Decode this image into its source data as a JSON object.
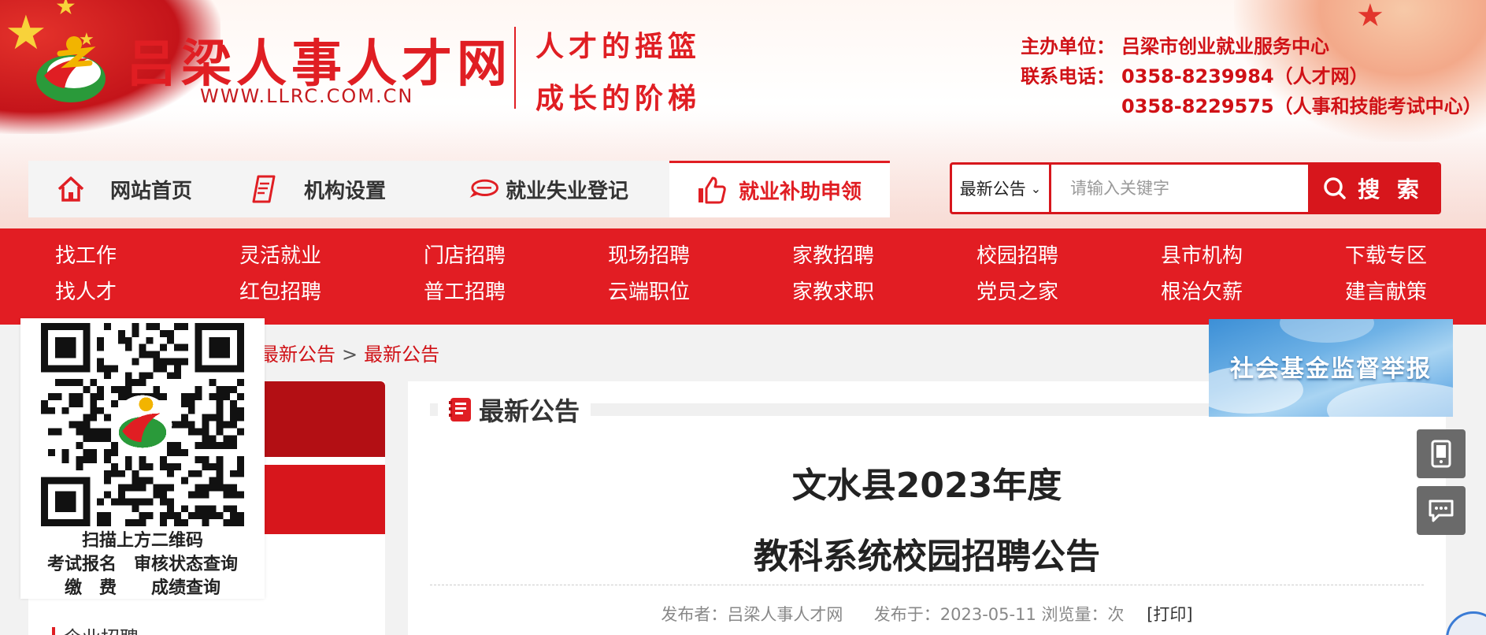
{
  "header": {
    "site_name": "吕梁人事人才网",
    "site_url": "WWW.LLRC.COM.CN",
    "slogan_line1": "人才的摇篮",
    "slogan_line2": "成长的阶梯",
    "host_label": "主办单位：",
    "host_value": "吕梁市创业就业服务中心",
    "phone_label": "联系电话：",
    "phone1": "0358-8239984（人才网）",
    "phone2": "0358-8229575（人事和技能考试中心）"
  },
  "topnav": {
    "items": [
      {
        "label": "网站首页",
        "icon": "home-icon"
      },
      {
        "label": "机构设置",
        "icon": "document-icon"
      },
      {
        "label": "就业失业登记",
        "icon": "speech-bubble-icon"
      },
      {
        "label": "就业补助申领",
        "icon": "thumbs-up-icon"
      }
    ],
    "active_index": 3
  },
  "search": {
    "category": "最新公告",
    "placeholder": "请输入关键字",
    "button_label": "搜 索"
  },
  "subnav": {
    "items": [
      "找工作",
      "灵活就业",
      "门店招聘",
      "现场招聘",
      "家教招聘",
      "校园招聘",
      "县市机构",
      "下载专区",
      "找人才",
      "红包招聘",
      "普工招聘",
      "云端职位",
      "家教求职",
      "党员之家",
      "根治欠薪",
      "建言献策"
    ]
  },
  "breadcrumb": {
    "items": [
      "最新公告",
      "最新公告"
    ],
    "separator": ">"
  },
  "qr_panel": {
    "line1": "扫描上方二维码",
    "line2": "考试报名　审核状态查询",
    "line3": "缴　费　　成绩查询"
  },
  "left_menu": {
    "item": "企业招聘"
  },
  "section": {
    "title": "最新公告"
  },
  "article": {
    "title_line1": "文水县2023年度",
    "title_line2": "教科系统校园招聘公告",
    "publisher_label": "发布者：",
    "publisher": "吕梁人事人才网",
    "date_label": "发布于：",
    "date": "2023-05-11",
    "views_label": "浏览量：",
    "views_unit": "次",
    "print_label": "[打印]"
  },
  "banner": {
    "text": "社会基金监督举报"
  },
  "colors": {
    "brand_red": "#e01e23",
    "nav_bg": "#f4f4f4",
    "float_btn": "#6a6a6a"
  }
}
